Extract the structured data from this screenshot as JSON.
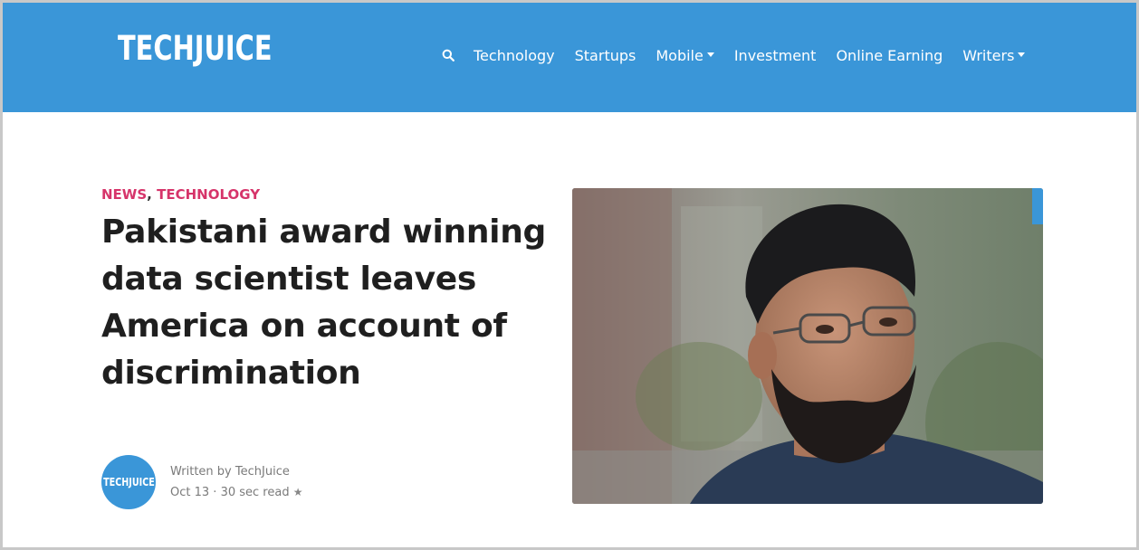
{
  "header": {
    "logo": "TECHJUICE",
    "brand_color": "#3a96d8",
    "search_icon": "search-icon",
    "nav": [
      {
        "label": "Technology",
        "dropdown": false
      },
      {
        "label": "Startups",
        "dropdown": false
      },
      {
        "label": "Mobile",
        "dropdown": true
      },
      {
        "label": "Investment",
        "dropdown": false
      },
      {
        "label": "Online Earning",
        "dropdown": false
      },
      {
        "label": "Writers",
        "dropdown": true
      }
    ]
  },
  "article": {
    "categories": [
      "NEWS",
      "TECHNOLOGY"
    ],
    "category_separator": ",",
    "category_color": "#d6346a",
    "headline": "Pakistani award winning data scientist leaves America on account of discrimination",
    "author": {
      "avatar_text": "TECHJUICE",
      "written_by": "Written by",
      "name": "TechJuice",
      "date": "Oct 13",
      "separator": "·",
      "read_time": "30 sec read",
      "star_icon": "star-icon"
    },
    "hero_image": "portrait-photo"
  }
}
